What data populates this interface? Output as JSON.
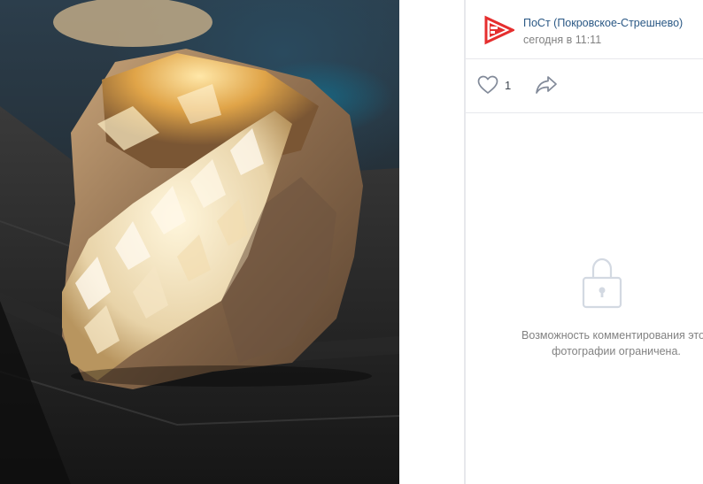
{
  "photo": {
    "subject": "mineral-crystal-photo"
  },
  "post": {
    "author": "ПоСт (Покровское-Стрешнево)",
    "date": "сегодня в 11:11",
    "avatar_icon": "post-logo-icon",
    "brand_color": "#e52e2e",
    "link_color": "#2a5885"
  },
  "actions": {
    "like_icon": "heart-icon",
    "like_count": "1",
    "share_icon": "share-arrow-icon"
  },
  "comments": {
    "icon": "lock-icon",
    "restricted_line1": "Возможность комментирования этой",
    "restricted_line2": "фотографии ограничена."
  }
}
